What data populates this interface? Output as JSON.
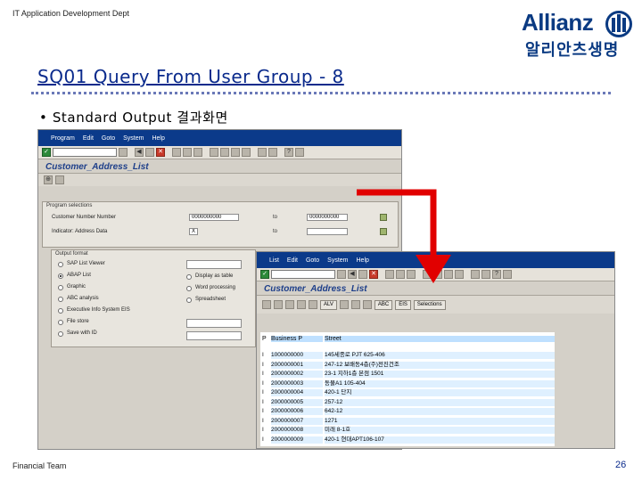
{
  "header": {
    "dept": "IT Application Development Dept"
  },
  "logo": {
    "word": "Allianz",
    "korean": "알리안츠생명"
  },
  "slide": {
    "title": "SQ01 Query From User Group - 8",
    "bullet": "•  Standard Output 결과화면",
    "footer": "Financial Team",
    "page": "26"
  },
  "sap1": {
    "menu": [
      "Program",
      "Edit",
      "Goto",
      "System",
      "Help"
    ],
    "screen_title": "Customer_Address_List",
    "selections": {
      "header": "Program selections",
      "rows": [
        {
          "label": "Customer Number Number",
          "from": "0000000000",
          "to_label": "to",
          "to": "0000000000"
        },
        {
          "label": "Indicator: Address Data",
          "from": "X",
          "to_label": "to",
          "to": ""
        }
      ]
    },
    "output": {
      "header": "Output format",
      "left": [
        {
          "label": "SAP List Viewer",
          "on": false
        },
        {
          "label": "ABAP List",
          "on": true
        },
        {
          "label": "Graphic",
          "on": false
        },
        {
          "label": "ABC analysis",
          "on": false
        },
        {
          "label": "Executive Info System EIS",
          "on": false
        },
        {
          "label": "File store",
          "on": false
        },
        {
          "label": "Save with ID",
          "on": false
        }
      ],
      "right": [
        {
          "label": "Display as table",
          "on": false
        },
        {
          "label": "Word processing",
          "on": false
        },
        {
          "label": "Spreadsheet",
          "on": false
        }
      ]
    }
  },
  "sap2": {
    "menu": [
      "List",
      "Edit",
      "Goto",
      "System",
      "Help"
    ],
    "screen_title": "Customer_Address_List",
    "app_buttons": [
      "ALV",
      "ABC",
      "EIS",
      "Selections"
    ],
    "columns": [
      "P",
      "Business P",
      "Street"
    ],
    "rows": [
      {
        "p": "I",
        "bp": "1000000000",
        "street": "145세종로 PJT 625-406"
      },
      {
        "p": "I",
        "bp": "2000000001",
        "street": "247-12 보배동4층(주)전진건조"
      },
      {
        "p": "I",
        "bp": "2000000002",
        "street": "23-1 지하1층 본점 1501"
      },
      {
        "p": "I",
        "bp": "2000000003",
        "street": "동물A1 105-404"
      },
      {
        "p": "I",
        "bp": "2000000004",
        "street": "420-1 단지"
      },
      {
        "p": "I",
        "bp": "2000000005",
        "street": "257-12"
      },
      {
        "p": "I",
        "bp": "2000000006",
        "street": "642-12"
      },
      {
        "p": "I",
        "bp": "2000000007",
        "street": "1271"
      },
      {
        "p": "I",
        "bp": "2000000008",
        "street": "미래 8-1호"
      },
      {
        "p": "I",
        "bp": "2000000009",
        "street": "420-1 현대APT106-107"
      }
    ]
  },
  "colors": {
    "title_blue": "#0a2a8c",
    "brand_blue": "#0a3a82",
    "arrow_red": "#e10000",
    "sap_menu": "#0b3a8a"
  }
}
